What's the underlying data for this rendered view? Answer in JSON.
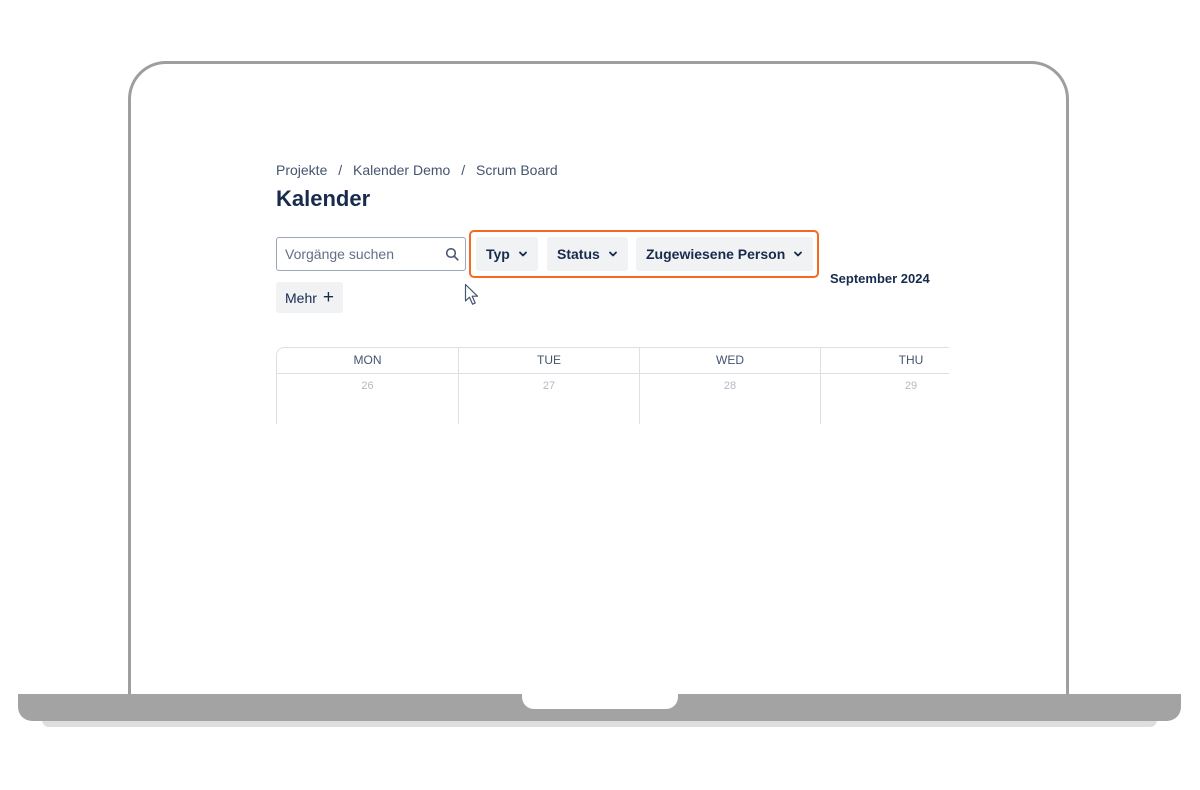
{
  "breadcrumb": {
    "items": [
      "Projekte",
      "Kalender Demo",
      "Scrum Board"
    ],
    "separator": "/"
  },
  "page": {
    "title": "Kalender"
  },
  "search": {
    "placeholder": "Vorgänge suchen",
    "value": ""
  },
  "filters": {
    "type_label": "Typ",
    "status_label": "Status",
    "assignee_label": "Zugewiesene Person",
    "more_label": "Mehr",
    "highlight_color": "#f26b21"
  },
  "calendar": {
    "month_label": "September 2024",
    "days": [
      {
        "name": "MON",
        "date": "26"
      },
      {
        "name": "TUE",
        "date": "27"
      },
      {
        "name": "WED",
        "date": "28"
      },
      {
        "name": "THU",
        "date": "29"
      }
    ]
  },
  "colors": {
    "text_primary": "#172b4d",
    "text_secondary": "#44546f",
    "button_bg": "#f1f2f4",
    "frame": "#9e9e9e"
  },
  "icons": {
    "search": "search-icon",
    "chevron": "chevron-down-icon",
    "plus": "plus-icon",
    "cursor": "mouse-pointer-icon"
  }
}
